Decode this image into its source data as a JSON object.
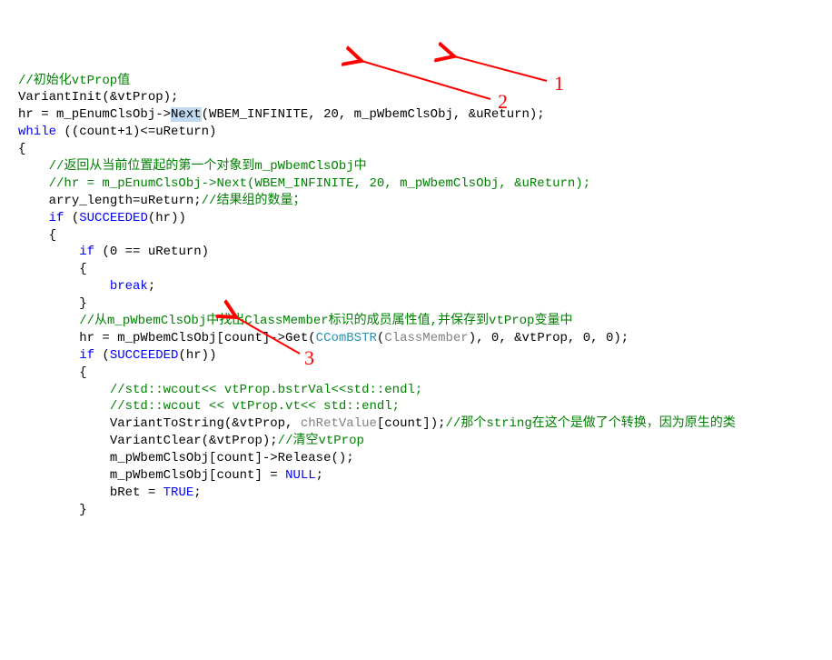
{
  "code": {
    "l01_comment": "//初始化vtProp值",
    "l02": "VariantInit(&vtProp);",
    "l03_a": "hr = m_pEnumClsObj->",
    "l03_next": "Next",
    "l03_b": "(WBEM_INFINITE, 20, m_pWbemClsObj, &uReturn);",
    "l04_while": "while",
    "l04_cond": " ((count+1)<=uReturn)",
    "l05": "{",
    "l06_comment": "//返回从当前位置起的第一个对象到m_pWbemClsObj中",
    "l07_comment": "//hr = m_pEnumClsObj->Next(WBEM_INFINITE, 20, m_pWbemClsObj, &uReturn);",
    "l08_a": "arry_length",
    "l08_b": "=uReturn;",
    "l08_comment": "//结果组的数量；",
    "l09_if": "if",
    "l09_a": " (",
    "l09_succ": "SUCCEEDED",
    "l09_b": "(hr))",
    "l10": "{",
    "l11_if": "if",
    "l11_a": " (0 == uReturn)",
    "l12": "{",
    "l13_break": "break",
    "l13_semi": ";",
    "l14": "}",
    "l15_comment": "//从m_pWbemClsObj中找出ClassMember标识的成员属性值,并保存到vtProp变量中",
    "l16_a": "hr = m_pWbemClsObj[count]->Get(",
    "l16_type": "CComBSTR",
    "l16_b": "(",
    "l16_grey": "ClassMember",
    "l16_c": "), 0, &vtProp, 0, 0);",
    "l17_if": "if",
    "l17_a": " (",
    "l17_succ": "SUCCEEDED",
    "l17_b": "(hr))",
    "l18": "{",
    "l19_comment": "//std::wcout<< vtProp.bstrVal<<std::endl;",
    "l20_comment": "//std::wcout << vtProp.vt<< std::endl;",
    "l21_a": "VariantToString(&vtProp, ",
    "l21_grey": "chRetValue",
    "l21_b": "[count]);",
    "l21_comment": "//那个string在这个是做了个转换，因为原生的类",
    "l22_a": "VariantClear(&vtProp);",
    "l22_comment": "//清空vtProp",
    "l23": "m_pWbemClsObj[count]->Release();",
    "l24_a": "m_pWbemClsObj[count] = ",
    "l24_null": "NULL",
    "l24_semi": ";",
    "l25_a": "bRet = ",
    "l25_true": "TRUE",
    "l25_semi": ";",
    "l26": "}"
  },
  "annotations": {
    "label_1": "1",
    "label_2": "2",
    "label_3": "3"
  }
}
